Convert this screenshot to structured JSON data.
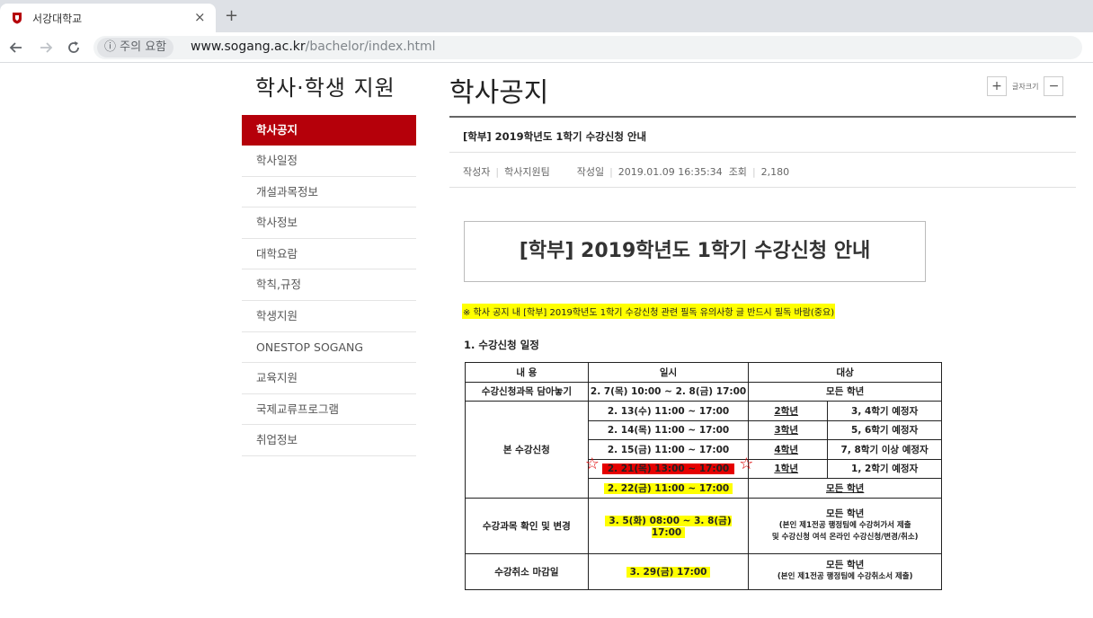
{
  "browser": {
    "tab_title": "서강대학교",
    "tab_close": "×",
    "new_tab": "+",
    "security_label": "주의 요함",
    "url_host": "www.sogang.ac.kr",
    "url_path": "/bachelor/index.html"
  },
  "sidebar": {
    "title": "학사·학생 지원",
    "items": [
      {
        "label": "학사공지",
        "active": true
      },
      {
        "label": "학사일정"
      },
      {
        "label": "개설과목정보"
      },
      {
        "label": "학사정보"
      },
      {
        "label": "대학요람"
      },
      {
        "label": "학칙,규정"
      },
      {
        "label": "학생지원"
      },
      {
        "label": "ONESTOP SOGANG"
      },
      {
        "label": "교육지원"
      },
      {
        "label": "국제교류프로그램"
      },
      {
        "label": "취업정보"
      }
    ]
  },
  "main": {
    "title": "학사공지",
    "font_size_label": "글자크기",
    "font_plus": "+",
    "font_minus": "−",
    "post": {
      "title": "[학부] 2019학년도 1학기 수강신청 안내",
      "author_label": "작성자",
      "author": "학사지원팀",
      "date_label": "작성일",
      "date": "2019.01.09 16:35:34",
      "views_label": "조회",
      "views": "2,180"
    },
    "banner": "[학부] 2019학년도 1학기 수강신청 안내",
    "notice": "※ 학사 공지 내 [학부] 2019학년도 1학기 수강신청 관련 필독 유의사항  글 반드시 필독 바람(중요)",
    "section_heading": "1. 수강신청 일정",
    "table": {
      "headers": [
        "내 용",
        "일시",
        "대상"
      ],
      "row_wishlist": {
        "label": "수강신청과목 담아놓기",
        "time": "2. 7(목) 10:00 ~ 2. 8(금) 17:00",
        "target": "모든 학년"
      },
      "main_label": "본 수강신청",
      "main_rows": [
        {
          "time": "2. 13(수) 11:00 ~ 17:00",
          "grade": "2학년",
          "detail": "3, 4학기 예정자"
        },
        {
          "time": "2. 14(목) 11:00 ~ 17:00",
          "grade": "3학년",
          "detail": "5, 6학기 예정자"
        },
        {
          "time": "2. 15(금) 11:00 ~ 17:00",
          "grade": "4학년",
          "detail": "7, 8학기 이상 예정자"
        },
        {
          "time": "2. 21(목) 13:00 ~ 17:00",
          "grade": "1학년",
          "detail": "1, 2학기 예정자"
        },
        {
          "time": "2. 22(금) 11:00 ~ 17:00",
          "grade_all": "모든 학년"
        }
      ],
      "row_change": {
        "label": "수강과목 확인 및 변경",
        "time": "3. 5(화) 08:00 ~ 3. 8(금) 17:00",
        "target": "모든 학년",
        "note1": "(본인 제1전공 행정팀에 수강허가서 제출",
        "note2": "및 수강신청 여석 온라인 수강신청/변경/취소)"
      },
      "row_cancel": {
        "label": "수강취소 마감일",
        "time": "3. 29(금) 17:00",
        "target": "모든 학년",
        "note": "(본인 제1전공 행정팀에 수강취소서 제출)"
      }
    }
  },
  "colors": {
    "accent": "#b5000a",
    "highlight": "#ffff00",
    "strike_red": "#e60000"
  }
}
